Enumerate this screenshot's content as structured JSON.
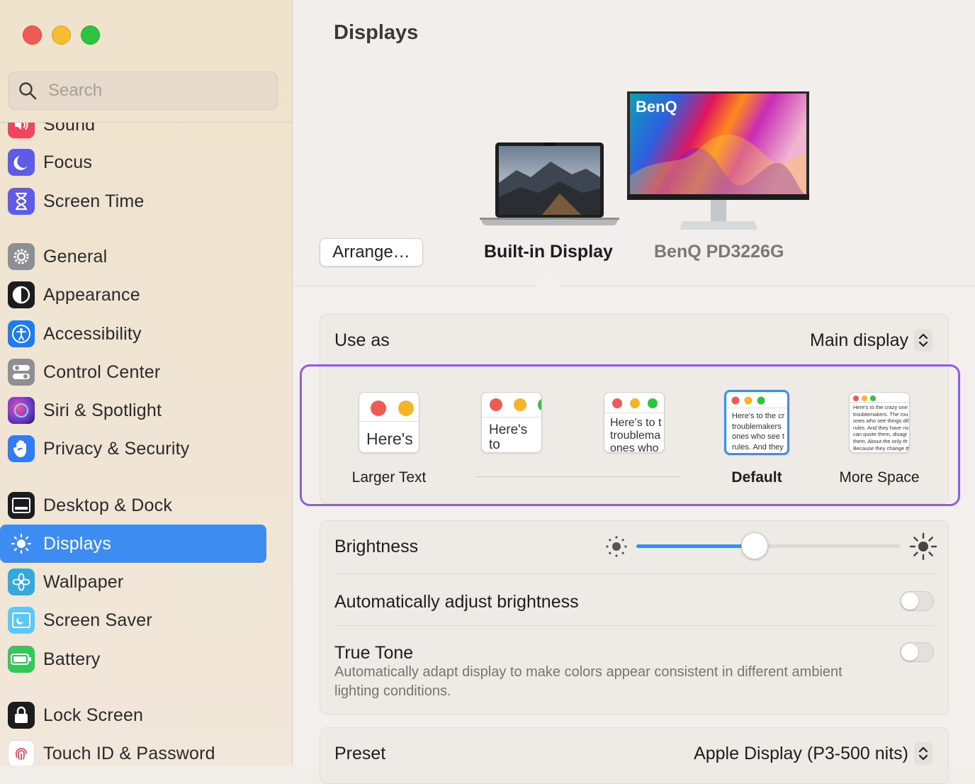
{
  "window": {
    "title": "Displays"
  },
  "search": {
    "placeholder": "Search"
  },
  "sidebar": {
    "items": [
      {
        "label": "Sound",
        "icon": "speaker-icon",
        "color": "#f0455a"
      },
      {
        "label": "Focus",
        "icon": "moon-icon",
        "color": "#5e5ce6"
      },
      {
        "label": "Screen Time",
        "icon": "hourglass-icon",
        "color": "#5e5ce6"
      },
      {
        "label": "General",
        "icon": "gear-icon",
        "color": "#8e8e93"
      },
      {
        "label": "Appearance",
        "icon": "appearance-icon",
        "color": "#1c1c1e"
      },
      {
        "label": "Accessibility",
        "icon": "accessibility-icon",
        "color": "#1e7cf2"
      },
      {
        "label": "Control Center",
        "icon": "toggles-icon",
        "color": "#8e8e93"
      },
      {
        "label": "Siri & Spotlight",
        "icon": "siri-icon",
        "color": "#6d3cd1"
      },
      {
        "label": "Privacy & Security",
        "icon": "hand-icon",
        "color": "#2f7cf6"
      },
      {
        "label": "Desktop & Dock",
        "icon": "dock-icon",
        "color": "#1c1c1e"
      },
      {
        "label": "Displays",
        "icon": "sun-icon",
        "color": "#3d8cf1"
      },
      {
        "label": "Wallpaper",
        "icon": "flower-icon",
        "color": "#34aadc"
      },
      {
        "label": "Screen Saver",
        "icon": "screensaver-icon",
        "color": "#5ac8fa"
      },
      {
        "label": "Battery",
        "icon": "battery-icon",
        "color": "#34c759"
      },
      {
        "label": "Lock Screen",
        "icon": "lock-icon",
        "color": "#1c1c1e"
      },
      {
        "label": "Touch ID & Password",
        "icon": "fingerprint-icon",
        "color": "#ffffff"
      }
    ],
    "active": "Displays"
  },
  "displays": {
    "arrange_label": "Arrange…",
    "builtin_label": "Built-in Display",
    "external_label": "BenQ PD3226G",
    "monitor_brand": "BenQ"
  },
  "use_as": {
    "label": "Use as",
    "value": "Main display"
  },
  "resolution": {
    "options": [
      {
        "label": "Larger Text",
        "sample": "Here's"
      },
      {
        "label": "",
        "sample": "Here's to troublem"
      },
      {
        "label": "",
        "sample": "Here's to t troublema ones who"
      },
      {
        "label": "Default",
        "sample": "Here's to the cr troublemakers ones who see t rules. And they"
      },
      {
        "label": "More Space",
        "sample": "Here's to the crazy one troublemakers. The rou ones who see things dif rules. And they have no can quote them, disagr them. About the only th Because they change th"
      }
    ],
    "selected": "Default"
  },
  "brightness": {
    "label": "Brightness",
    "value": 0.45
  },
  "auto_brightness": {
    "label": "Automatically adjust brightness",
    "enabled": false
  },
  "true_tone": {
    "label": "True Tone",
    "description": "Automatically adapt display to make colors appear consistent in different ambient lighting conditions.",
    "enabled": false
  },
  "preset": {
    "label": "Preset",
    "value": "Apple Display (P3-500 nits)"
  },
  "colors": {
    "accent": "#3d8cf1",
    "highlight_frame": "#8e5de6"
  }
}
